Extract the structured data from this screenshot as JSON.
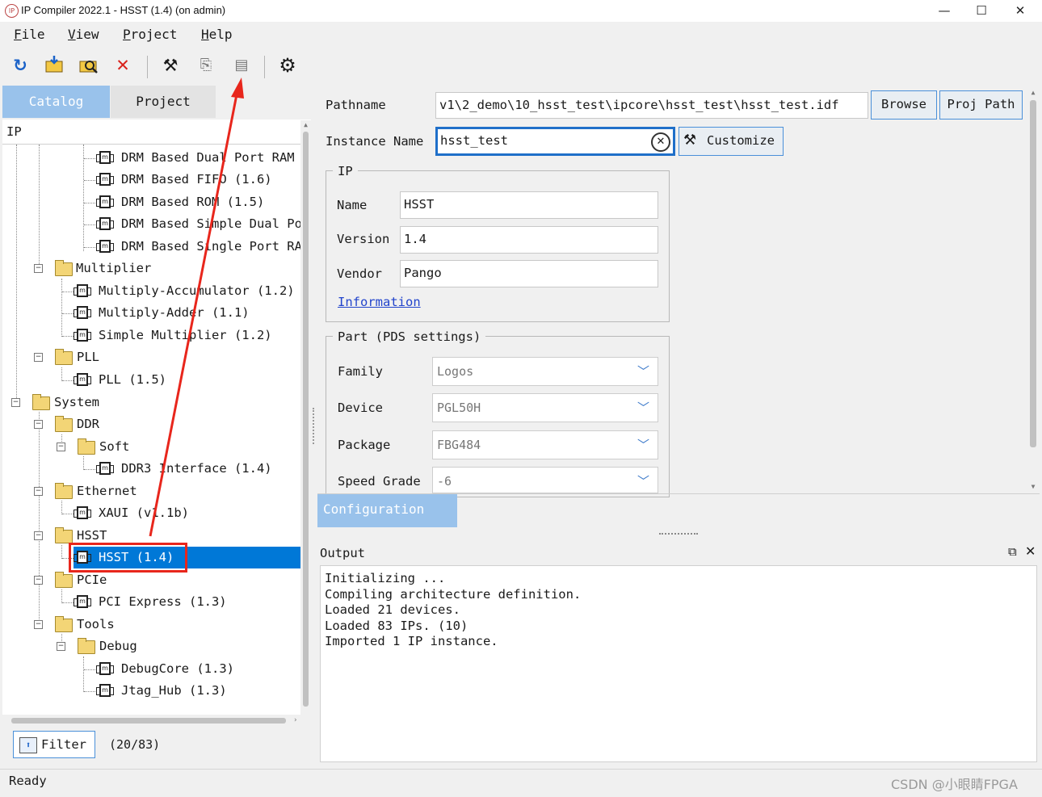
{
  "window": {
    "title": "IP Compiler 2022.1 - HSST (1.4) (on admin)",
    "app_icon_text": "IP",
    "minimize": "—",
    "maximize": "☐",
    "close": "✕"
  },
  "menu": {
    "items": [
      {
        "label": "File",
        "key": "F"
      },
      {
        "label": "View",
        "key": "V"
      },
      {
        "label": "Project",
        "key": "P"
      },
      {
        "label": "Help",
        "key": "H"
      }
    ]
  },
  "toolbar": {
    "icons": [
      "refresh-icon",
      "open-folder-icon",
      "find-icon",
      "delete-icon",
      "tools-icon",
      "export-icon",
      "document-icon",
      "settings-gear-icon"
    ]
  },
  "left": {
    "tabs": [
      {
        "label": "Catalog",
        "active": true
      },
      {
        "label": "Project",
        "active": false
      }
    ],
    "tree_header": "IP",
    "tree": [
      {
        "label": "DRM Based Dual Port RAM",
        "type": "ip",
        "depth": 4
      },
      {
        "label": "DRM Based FIFO (1.6)",
        "type": "ip",
        "depth": 4
      },
      {
        "label": "DRM Based ROM (1.5)",
        "type": "ip",
        "depth": 4
      },
      {
        "label": "DRM Based Simple Dual Port RAM",
        "type": "ip",
        "depth": 4
      },
      {
        "label": "DRM Based Single Port RAM",
        "type": "ip",
        "depth": 4
      },
      {
        "label": "Multiplier",
        "type": "folder",
        "depth": 2
      },
      {
        "label": "Multiply-Accumulator (1.2)",
        "type": "ip",
        "depth": 3
      },
      {
        "label": "Multiply-Adder (1.1)",
        "type": "ip",
        "depth": 3
      },
      {
        "label": "Simple Multiplier (1.2)",
        "type": "ip",
        "depth": 3
      },
      {
        "label": "PLL",
        "type": "folder",
        "depth": 2
      },
      {
        "label": "PLL (1.5)",
        "type": "ip",
        "depth": 3
      },
      {
        "label": "System",
        "type": "folder",
        "depth": 1
      },
      {
        "label": "DDR",
        "type": "folder",
        "depth": 2
      },
      {
        "label": "Soft",
        "type": "folder",
        "depth": 3
      },
      {
        "label": "DDR3 Interface (1.4)",
        "type": "ip",
        "depth": 4
      },
      {
        "label": "Ethernet",
        "type": "folder",
        "depth": 2
      },
      {
        "label": "XAUI (v1.1b)",
        "type": "ip",
        "depth": 3
      },
      {
        "label": "HSST",
        "type": "folder",
        "depth": 2
      },
      {
        "label": "HSST (1.4)",
        "type": "ip",
        "depth": 3,
        "selected": true
      },
      {
        "label": "PCIe",
        "type": "folder",
        "depth": 2
      },
      {
        "label": "PCI Express (1.3)",
        "type": "ip",
        "depth": 3
      },
      {
        "label": "Tools",
        "type": "folder",
        "depth": 2
      },
      {
        "label": "Debug",
        "type": "folder",
        "depth": 3
      },
      {
        "label": "DebugCore (1.3)",
        "type": "ip",
        "depth": 4
      },
      {
        "label": "Jtag_Hub (1.3)",
        "type": "ip",
        "depth": 4
      }
    ],
    "filter_label": "Filter",
    "filter_count": "(20/83)"
  },
  "right": {
    "pathname_label": "Pathname",
    "pathname_value": "v1\\2_demo\\10_hsst_test\\ipcore\\hsst_test\\hsst_test.idf",
    "browse_label": "Browse",
    "proj_path_label": "Proj Path",
    "instance_label": "Instance Name",
    "instance_value": "hsst_test",
    "customize_label": "Customize",
    "ip_group": {
      "title": "IP",
      "name_label": "Name",
      "name_value": "HSST",
      "version_label": "Version",
      "version_value": "1.4",
      "vendor_label": "Vendor",
      "vendor_value": "Pango",
      "info_link": "Information"
    },
    "part_group": {
      "title": "Part (PDS settings)",
      "family_label": "Family",
      "family_value": "Logos",
      "device_label": "Device",
      "device_value": "PGL50H",
      "package_label": "Package",
      "package_value": "FBG484",
      "speed_label": "Speed Grade",
      "speed_value": "-6"
    },
    "config_tab": "Configuration"
  },
  "output": {
    "title": "Output",
    "lines": [
      "Initializing ...",
      "Compiling architecture definition.",
      "Loaded 21 devices.",
      "Loaded 83 IPs. (10)",
      "Imported 1 IP instance."
    ]
  },
  "status": {
    "text": "Ready",
    "watermark": "CSDN @小眼睛FPGA"
  },
  "colors": {
    "selection": "#0078d7",
    "annotation_red": "#e8261c",
    "tab_active": "#99c2eb",
    "button_border": "#4a90d9"
  }
}
